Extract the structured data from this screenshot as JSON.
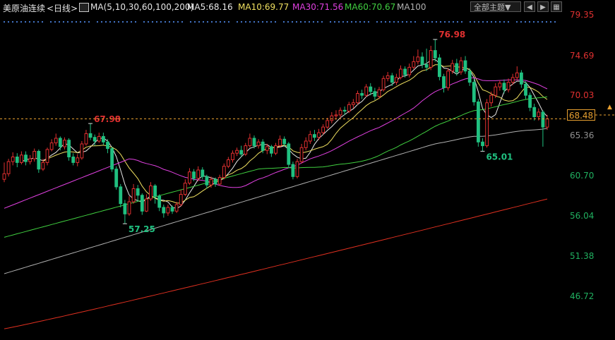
{
  "header": {
    "instrument": "美原油连续",
    "period_label": "<日线>",
    "indicator": "MA(5,10,30,60,100,200)",
    "ma5": "MA5:68.16",
    "ma10": "MA10:69.77",
    "ma30": "MA30:71.56",
    "ma60": "MA60:70.67",
    "ma100": "MA100",
    "theme_select": "全部主题▼",
    "icons": [
      "ma-settings-icon",
      "prev-icon",
      "next-icon",
      "grid-icon"
    ]
  },
  "axis": {
    "ticks": [
      "79.35",
      "74.69",
      "70.03",
      "65.36",
      "60.70",
      "56.04",
      "51.38",
      "46.72"
    ],
    "current_price": "68.48"
  },
  "colors": {
    "up": "#e03030",
    "down": "#20c080",
    "ma5": "#e8e8e8",
    "ma10": "#f0e060",
    "ma30": "#e040e0",
    "ma60": "#40d040",
    "ma100": "#b0b0b0",
    "ma200": "#e03020",
    "price_line": "#e8a030"
  },
  "chart_data": {
    "type": "candlestick",
    "ylim": [
      44.8,
      80.6
    ],
    "annotations": {
      "high": {
        "label": "76.98",
        "value": 76.98
      },
      "low": {
        "label": "57.25",
        "value": 57.25
      },
      "low2": {
        "label": "65.01",
        "value": 65.01
      },
      "prev_high": {
        "label": "67.98",
        "value": 67.98
      }
    },
    "current_price": 68.48,
    "candles": [
      [
        62.0,
        62.6,
        63.8,
        61.7
      ],
      [
        62.6,
        63.9,
        64.2,
        62.3
      ],
      [
        63.9,
        64.4,
        64.9,
        63.5
      ],
      [
        64.4,
        63.8,
        64.8,
        63.3
      ],
      [
        63.8,
        64.6,
        65.0,
        63.6
      ],
      [
        64.6,
        63.9,
        65.0,
        63.5
      ],
      [
        63.9,
        64.2,
        64.6,
        63.6
      ],
      [
        64.2,
        65.0,
        65.3,
        63.9
      ],
      [
        65.0,
        63.1,
        65.2,
        62.7
      ],
      [
        63.1,
        63.8,
        64.2,
        62.9
      ],
      [
        63.8,
        65.2,
        65.4,
        63.5
      ],
      [
        65.2,
        65.9,
        66.3,
        65.0
      ],
      [
        65.9,
        66.4,
        66.9,
        65.6
      ],
      [
        66.4,
        65.5,
        66.6,
        65.1
      ],
      [
        65.5,
        66.2,
        66.5,
        65.2
      ],
      [
        66.2,
        64.4,
        66.4,
        64.0
      ],
      [
        64.4,
        63.8,
        64.8,
        63.5
      ],
      [
        63.8,
        64.3,
        64.7,
        63.4
      ],
      [
        64.3,
        65.8,
        66.1,
        64.1
      ],
      [
        65.8,
        66.9,
        67.3,
        65.6
      ],
      [
        66.9,
        66.5,
        67.98,
        66.2
      ],
      [
        66.5,
        66.1,
        66.8,
        65.6
      ],
      [
        66.1,
        66.6,
        67.0,
        65.9
      ],
      [
        66.6,
        66.0,
        67.0,
        65.7
      ],
      [
        66.0,
        65.3,
        66.3,
        64.8
      ],
      [
        65.3,
        63.1,
        65.5,
        62.8
      ],
      [
        63.1,
        61.2,
        63.4,
        60.9
      ],
      [
        61.2,
        59.4,
        61.5,
        59.0
      ],
      [
        59.4,
        58.3,
        59.8,
        57.25
      ],
      [
        58.3,
        59.6,
        60.2,
        58.1
      ],
      [
        59.6,
        61.0,
        61.5,
        59.4
      ],
      [
        61.0,
        60.3,
        61.4,
        59.6
      ],
      [
        60.3,
        58.6,
        60.5,
        58.2
      ],
      [
        58.6,
        59.9,
        60.4,
        58.5
      ],
      [
        59.9,
        61.3,
        61.7,
        59.7
      ],
      [
        61.3,
        60.2,
        61.5,
        59.4
      ],
      [
        60.2,
        59.0,
        60.4,
        58.6
      ],
      [
        59.0,
        58.4,
        59.3,
        57.9
      ],
      [
        58.4,
        59.0,
        59.3,
        58.1
      ],
      [
        59.0,
        58.6,
        59.2,
        58.3
      ],
      [
        58.6,
        59.3,
        59.6,
        58.4
      ],
      [
        59.3,
        60.4,
        60.9,
        59.1
      ],
      [
        60.4,
        61.6,
        62.0,
        60.2
      ],
      [
        61.6,
        62.8,
        63.2,
        61.4
      ],
      [
        62.8,
        62.1,
        63.1,
        61.8
      ],
      [
        62.1,
        63.0,
        63.4,
        61.8
      ],
      [
        63.0,
        62.3,
        63.3,
        62.0
      ],
      [
        62.3,
        61.4,
        62.5,
        61.0
      ],
      [
        61.4,
        62.0,
        62.3,
        61.1
      ],
      [
        62.0,
        61.5,
        62.2,
        61.2
      ],
      [
        61.5,
        62.2,
        62.5,
        61.3
      ],
      [
        62.2,
        63.4,
        63.7,
        62.0
      ],
      [
        63.4,
        64.1,
        64.4,
        63.2
      ],
      [
        64.1,
        64.8,
        65.1,
        63.8
      ],
      [
        64.8,
        65.1,
        65.4,
        64.5
      ],
      [
        65.1,
        64.7,
        65.6,
        64.4
      ],
      [
        64.7,
        65.6,
        65.9,
        64.5
      ],
      [
        65.6,
        66.4,
        66.9,
        65.4
      ],
      [
        66.4,
        65.6,
        66.7,
        65.3
      ],
      [
        65.6,
        66.0,
        66.3,
        65.3
      ],
      [
        66.0,
        65.1,
        66.3,
        64.8
      ],
      [
        65.1,
        65.5,
        65.8,
        64.7
      ],
      [
        65.5,
        64.8,
        65.7,
        64.4
      ],
      [
        64.8,
        65.6,
        65.9,
        64.6
      ],
      [
        65.6,
        66.3,
        66.7,
        65.4
      ],
      [
        66.3,
        65.8,
        66.6,
        65.5
      ],
      [
        65.8,
        63.6,
        66.0,
        63.2
      ],
      [
        63.6,
        62.3,
        63.9,
        62.0
      ],
      [
        62.3,
        63.9,
        64.2,
        62.1
      ],
      [
        63.9,
        65.4,
        65.8,
        63.7
      ],
      [
        65.4,
        66.1,
        66.5,
        65.1
      ],
      [
        66.1,
        66.8,
        67.2,
        65.8
      ],
      [
        66.8,
        66.5,
        67.3,
        66.1
      ],
      [
        66.5,
        67.0,
        67.4,
        66.2
      ],
      [
        67.0,
        67.6,
        67.9,
        66.8
      ],
      [
        67.6,
        68.3,
        68.6,
        67.4
      ],
      [
        68.3,
        68.8,
        69.2,
        68.0
      ],
      [
        68.8,
        68.9,
        69.4,
        68.4
      ],
      [
        68.9,
        69.4,
        69.7,
        68.6
      ],
      [
        69.4,
        69.3,
        69.8,
        68.9
      ],
      [
        69.3,
        70.0,
        70.3,
        69.1
      ],
      [
        70.0,
        70.2,
        70.6,
        69.6
      ],
      [
        70.2,
        71.2,
        71.5,
        70.0
      ],
      [
        71.2,
        71.0,
        71.6,
        70.6
      ],
      [
        71.0,
        71.9,
        72.2,
        70.8
      ],
      [
        71.9,
        71.4,
        72.3,
        71.0
      ],
      [
        71.4,
        70.9,
        71.8,
        70.5
      ],
      [
        70.9,
        71.6,
        71.9,
        70.6
      ],
      [
        71.6,
        72.8,
        73.1,
        71.4
      ],
      [
        72.8,
        73.1,
        73.5,
        72.5
      ],
      [
        73.1,
        72.4,
        73.4,
        72.0
      ],
      [
        72.4,
        72.9,
        73.3,
        72.1
      ],
      [
        72.9,
        73.8,
        74.2,
        72.7
      ],
      [
        73.8,
        73.2,
        74.1,
        72.9
      ],
      [
        73.2,
        74.0,
        74.4,
        72.9
      ],
      [
        74.0,
        74.6,
        75.2,
        73.8
      ],
      [
        74.6,
        75.1,
        75.9,
        74.3
      ],
      [
        75.1,
        74.3,
        75.6,
        73.9
      ],
      [
        74.3,
        74.0,
        76.0,
        73.6
      ],
      [
        74.0,
        75.8,
        76.3,
        73.7
      ],
      [
        75.8,
        75.0,
        76.98,
        74.6
      ],
      [
        75.0,
        73.0,
        75.4,
        72.6
      ],
      [
        73.0,
        71.8,
        73.3,
        71.3
      ],
      [
        71.8,
        73.6,
        73.9,
        71.5
      ],
      [
        73.6,
        74.4,
        74.8,
        73.3
      ],
      [
        74.4,
        73.5,
        74.9,
        73.1
      ],
      [
        73.5,
        74.7,
        75.1,
        73.2
      ],
      [
        74.7,
        73.6,
        75.2,
        73.3
      ],
      [
        73.6,
        72.4,
        73.9,
        72.0
      ],
      [
        72.4,
        70.3,
        72.7,
        69.9
      ],
      [
        70.3,
        66.0,
        70.6,
        65.5
      ],
      [
        66.0,
        65.6,
        66.4,
        65.01
      ],
      [
        65.6,
        70.2,
        70.6,
        65.4
      ],
      [
        70.2,
        71.0,
        71.4,
        69.8
      ],
      [
        71.0,
        71.9,
        72.3,
        70.7
      ],
      [
        71.9,
        72.3,
        72.6,
        71.5
      ],
      [
        72.3,
        71.6,
        72.7,
        71.2
      ],
      [
        71.6,
        72.4,
        72.8,
        71.3
      ],
      [
        72.4,
        72.9,
        73.3,
        72.1
      ],
      [
        72.9,
        73.4,
        74.1,
        72.6
      ],
      [
        73.4,
        72.2,
        73.7,
        71.8
      ],
      [
        72.2,
        71.0,
        72.5,
        70.6
      ],
      [
        71.0,
        69.7,
        71.3,
        69.3
      ],
      [
        69.7,
        68.7,
        70.1,
        68.3
      ],
      [
        68.7,
        69.2,
        69.6,
        68.3
      ],
      [
        69.2,
        67.6,
        69.4,
        65.5
      ],
      [
        67.6,
        68.48,
        68.9,
        67.3
      ]
    ]
  }
}
